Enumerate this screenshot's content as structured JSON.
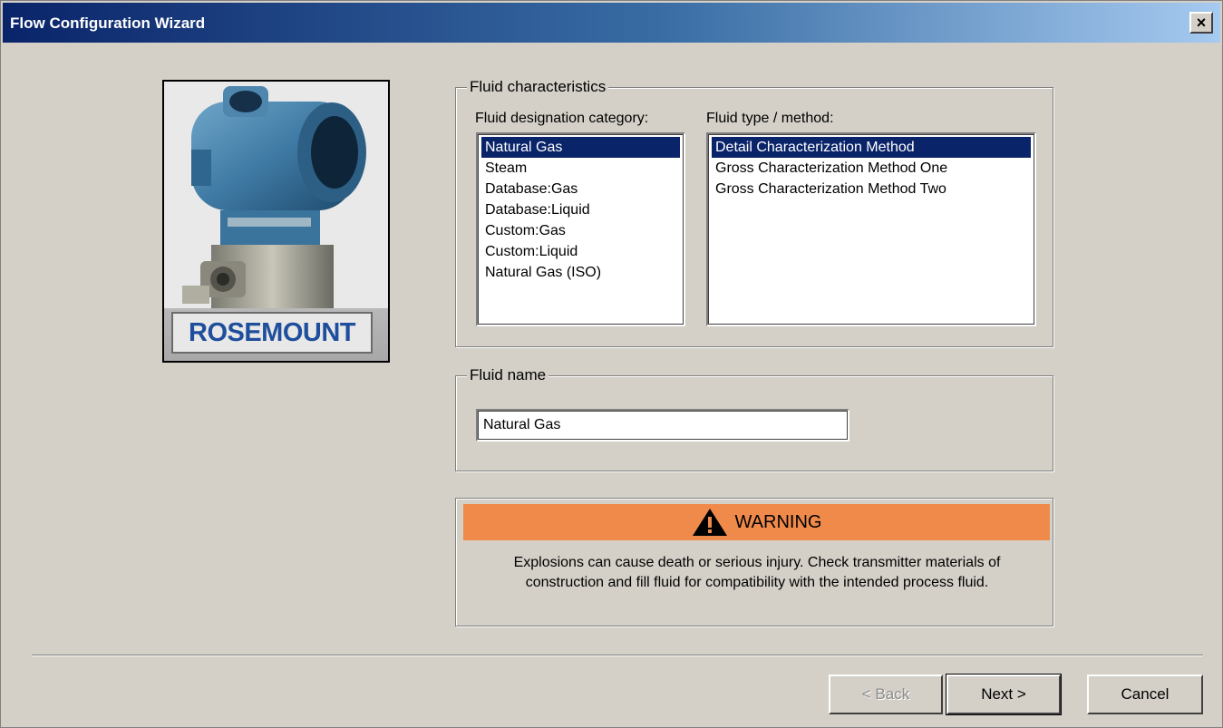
{
  "window": {
    "title": "Flow Configuration Wizard",
    "close_label": "×"
  },
  "product_image": {
    "brand": "ROSEMOUNT"
  },
  "fluid_characteristics": {
    "legend": "Fluid characteristics",
    "category_label": "Fluid designation category:",
    "categories": [
      "Natural Gas",
      "Steam",
      "Database:Gas",
      "Database:Liquid",
      "Custom:Gas",
      "Custom:Liquid",
      "Natural Gas (ISO)"
    ],
    "selected_category": 0,
    "method_label": "Fluid type / method:",
    "methods": [
      "Detail Characterization Method",
      "Gross Characterization Method One",
      "Gross Characterization Method Two"
    ],
    "selected_method": 0
  },
  "fluid_name": {
    "legend": "Fluid name",
    "value": "Natural Gas"
  },
  "warning": {
    "title": "WARNING",
    "line1": "Explosions can cause death or serious injury. Check transmitter materials of",
    "line2": "construction and fill fluid for compatibility with the intended process fluid.",
    "header_color": "#f08a4b"
  },
  "buttons": {
    "back": "< Back",
    "next": "Next >",
    "cancel": "Cancel"
  },
  "colors": {
    "selection": "#0a246a",
    "face": "#d4d0c8"
  }
}
